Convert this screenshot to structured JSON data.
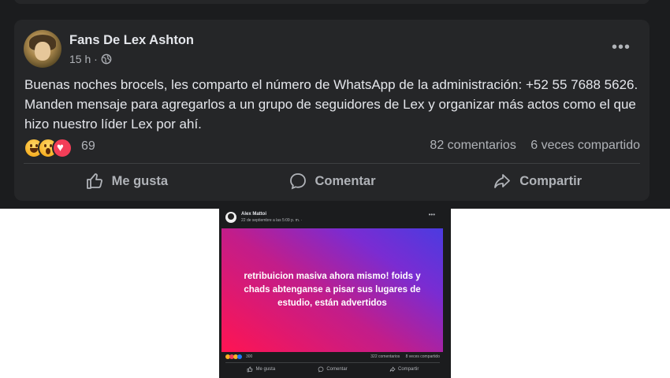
{
  "post1": {
    "author": "Fans De Lex Ashton",
    "time": "15 h ·",
    "privacy_icon": "globe-icon",
    "more_icon": "•••",
    "body": "Buenas noches brocels, les comparto el número de WhatsApp de la administración: +52 55 7688 5626. Manden mensaje para agregarlos a un grupo de seguidores de Lex y organizar más actos como el que hizo nuestro líder Lex por ahí.",
    "reaction_icons": [
      "haha-icon",
      "wow-icon",
      "love-icon"
    ],
    "reaction_count": "69",
    "comments": "82 comentarios",
    "shares": "6 veces compartido",
    "actions": {
      "like": "Me gusta",
      "comment": "Comentar",
      "share": "Compartir"
    }
  },
  "post2": {
    "author": "Alex Mattoi",
    "time": "22 de septiembre a las 5:09 p. m. ·",
    "more_icon": "•••",
    "card_text": "retribuicion masiva ahora mismo! foids y chads abtenganse a pisar sus lugares de estudio, están advertidos",
    "reaction_count": "300",
    "comments": "322 comentarios",
    "shares": "8 veces compartido",
    "actions": {
      "like": "Me gusta",
      "comment": "Comentar",
      "share": "Compartir"
    }
  },
  "colors": {
    "dark_bg": "#1b1c1e",
    "card_bg": "#252628",
    "text_primary": "#e4e6eb",
    "text_secondary": "#b0b3b8",
    "gradient_start": "#ff1452",
    "gradient_end": "#4b3be0"
  }
}
